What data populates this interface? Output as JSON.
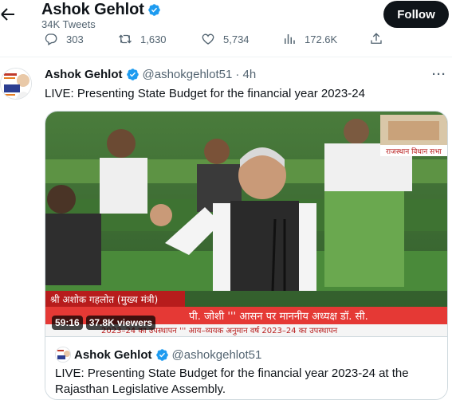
{
  "header": {
    "name": "Ashok Gehlot",
    "tweet_count": "34K Tweets",
    "follow_label": "Follow"
  },
  "actions": {
    "replies": "303",
    "retweets": "1,630",
    "likes": "5,734",
    "views": "172.6K"
  },
  "tweet": {
    "name": "Ashok Gehlot",
    "handle": "@ashokgehlot51",
    "time": "· 4h",
    "text": "LIVE: Presenting State Budget for the financial year 2023-24"
  },
  "video": {
    "duration": "59:16",
    "viewers": "37.8K viewers"
  },
  "quote": {
    "name": "Ashok Gehlot",
    "handle": "@ashokgehlot51",
    "text": "LIVE: Presenting State Budget for the financial year 2023-24 at the Rajasthan Legislative Assembly."
  },
  "colors": {
    "verified": "#1d9bf0",
    "text": "#0f1419",
    "muted": "#536471"
  }
}
